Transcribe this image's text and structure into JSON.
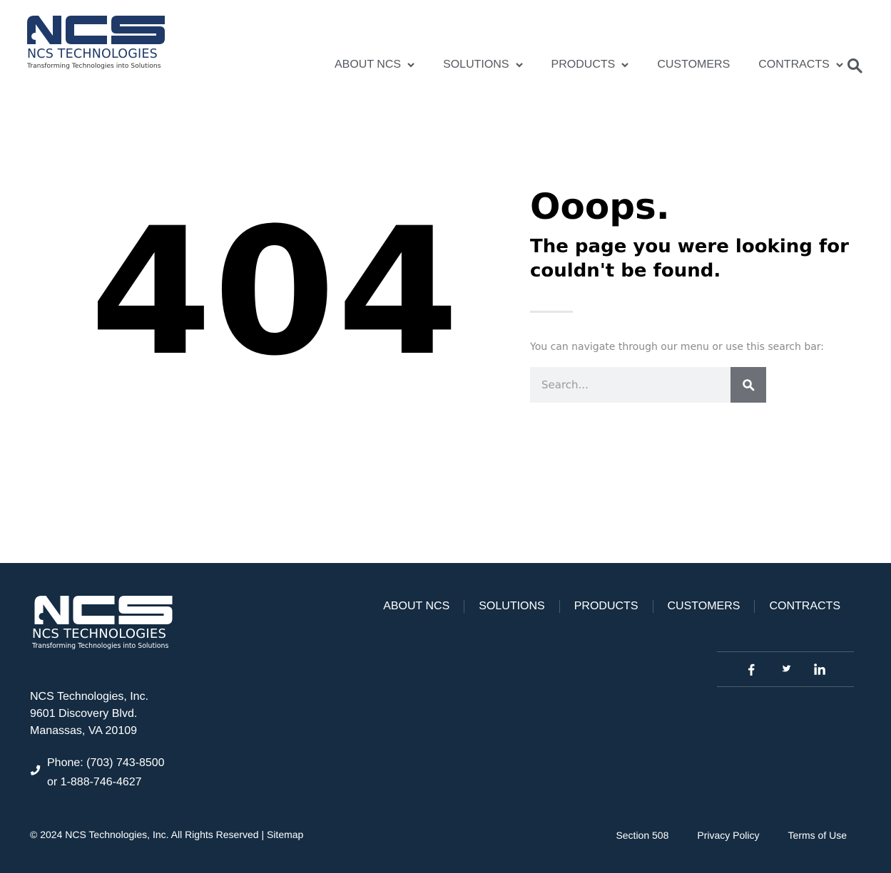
{
  "header": {
    "logo": {
      "name": "NCS TECHNOLOGIES",
      "tagline": "Transforming Technologies into Solutions",
      "mark_color": "#1f3a68"
    },
    "nav": [
      {
        "label": "ABOUT NCS",
        "has_dropdown": true
      },
      {
        "label": "SOLUTIONS",
        "has_dropdown": true
      },
      {
        "label": "PRODUCTS",
        "has_dropdown": true
      },
      {
        "label": "CUSTOMERS",
        "has_dropdown": false
      },
      {
        "label": "CONTRACTS",
        "has_dropdown": true
      }
    ],
    "search_icon": "search-icon"
  },
  "main": {
    "code": "404",
    "heading": "Ooops.",
    "subheading": "The page you were looking for couldn't be found.",
    "hint": "You can navigate through our menu or use this search bar:",
    "search": {
      "placeholder": "Search...",
      "value": "",
      "button_icon": "search-icon"
    }
  },
  "footer": {
    "background": "#152c42",
    "logo": {
      "name": "NCS TECHNOLOGIES",
      "tagline": "Transforming Technologies into Solutions"
    },
    "nav": [
      "ABOUT NCS",
      "SOLUTIONS",
      "PRODUCTS",
      "CUSTOMERS",
      "CONTRACTS"
    ],
    "social": [
      "facebook-icon",
      "twitter-icon",
      "linkedin-icon"
    ],
    "address": {
      "company": "NCS Technologies, Inc.",
      "street": "9601 Discovery Blvd.",
      "city": "Manassas, VA 20109"
    },
    "phone": {
      "line1": "Phone: (703) 743-8500",
      "line2": "or 1-888-746-4627",
      "icon": "phone-icon"
    },
    "copyright": "© 2024 NCS Technologies, Inc. All Rights Reserved | ",
    "sitemap": "Sitemap",
    "legal": [
      "Section 508",
      "Privacy Policy",
      "Terms of Use"
    ]
  }
}
